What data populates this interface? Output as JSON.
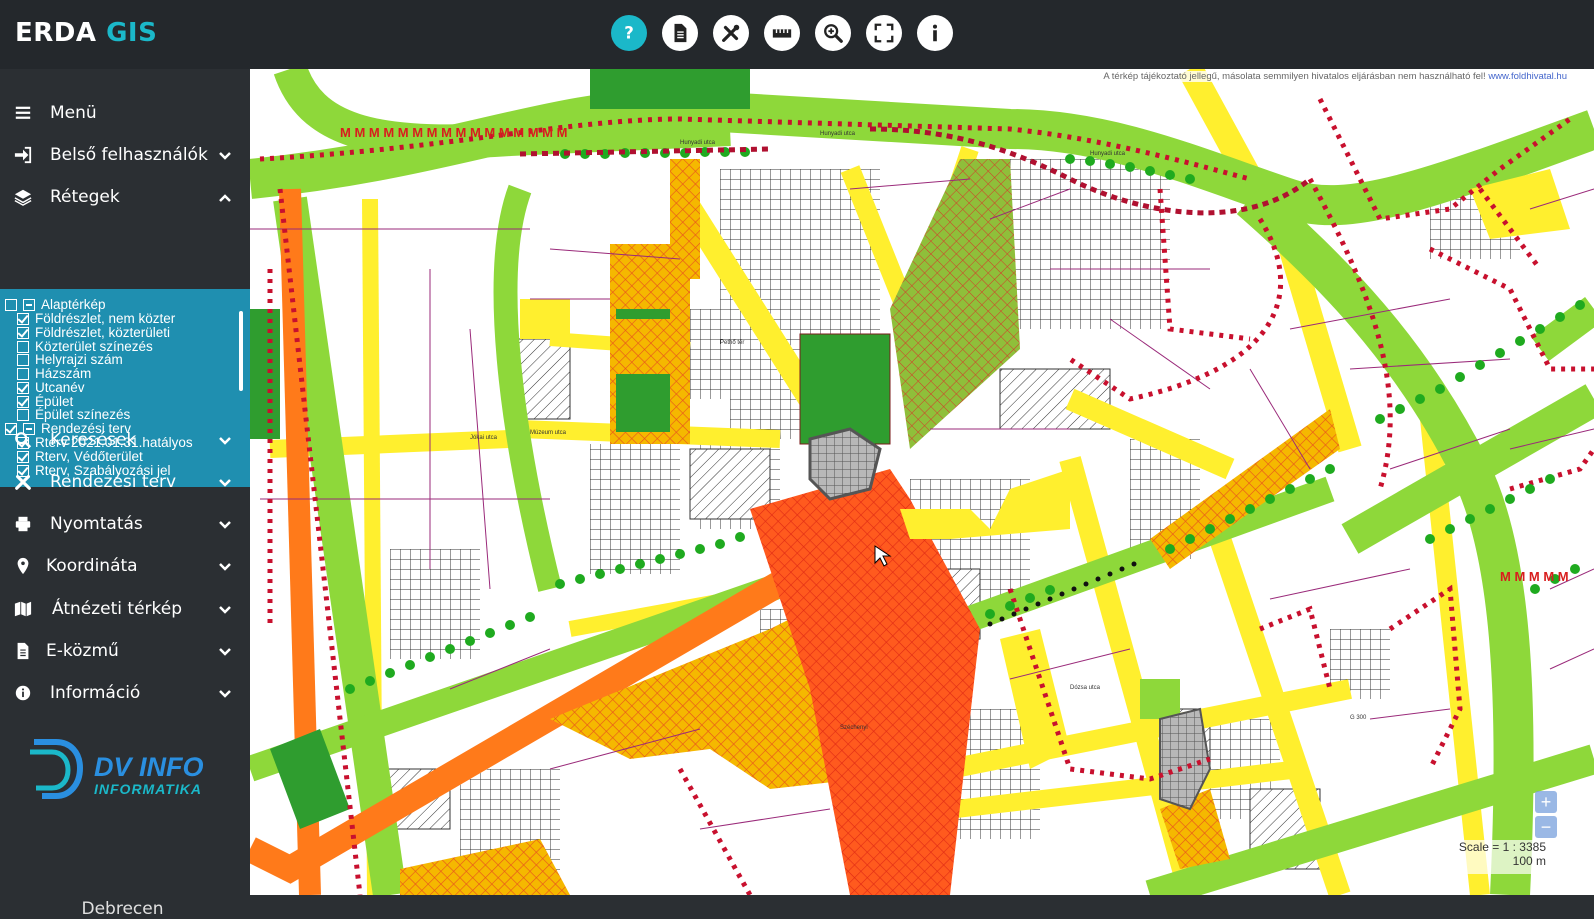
{
  "app": {
    "brand_main": "ERDA",
    "brand_accent": "GIS"
  },
  "toolbar": [
    {
      "name": "help-icon",
      "active": true
    },
    {
      "name": "document-icon",
      "active": false
    },
    {
      "name": "tools-icon",
      "active": false
    },
    {
      "name": "ruler-icon",
      "active": false
    },
    {
      "name": "zoom-icon",
      "active": false
    },
    {
      "name": "fullscreen-icon",
      "active": false
    },
    {
      "name": "info-icon",
      "active": false
    }
  ],
  "sidebar": {
    "menu": {
      "label": "Menü",
      "icon": "hamburger-icon"
    },
    "items": [
      {
        "label": "Belső felhasználók",
        "icon": "sign-in-icon",
        "expanded": false
      },
      {
        "label": "Rétegek",
        "icon": "layers-icon",
        "expanded": true
      },
      {
        "label": "Keresések",
        "icon": "search-icon",
        "expanded": false
      },
      {
        "label": "Rendezési terv",
        "icon": "tools-icon",
        "expanded": false
      },
      {
        "label": "Nyomtatás",
        "icon": "print-icon",
        "expanded": false
      },
      {
        "label": "Koordináta",
        "icon": "map-marker-icon",
        "expanded": false
      },
      {
        "label": "Átnézeti térkép",
        "icon": "map-icon",
        "expanded": false
      },
      {
        "label": "E-közmű",
        "icon": "file-icon",
        "expanded": false
      },
      {
        "label": "Információ",
        "icon": "info-circle-icon",
        "expanded": false
      }
    ],
    "layers": [
      {
        "label": "Alaptérkép",
        "type": "group"
      },
      {
        "label": "Földrészlet, nem közter",
        "checked": true
      },
      {
        "label": "Földrészlet, közterületi",
        "checked": true
      },
      {
        "label": "Közterület színezés",
        "checked": false
      },
      {
        "label": "Helyrajzi szám",
        "checked": false
      },
      {
        "label": "Házszám",
        "checked": false
      },
      {
        "label": "Utcanév",
        "checked": true
      },
      {
        "label": "Épület",
        "checked": true
      },
      {
        "label": "Épület színezés",
        "checked": false
      },
      {
        "label": "Rendezési terv",
        "type": "group"
      },
      {
        "label": "Rterv 2021.01.31.hatályos",
        "checked": true
      },
      {
        "label": "Rterv, Védőterület",
        "checked": true
      },
      {
        "label": "Rterv, Szabályozási jel",
        "checked": true
      }
    ],
    "logo": {
      "line1": "DV INFO",
      "line2": "INFORMATIKA"
    },
    "city": "Debrecen"
  },
  "map": {
    "disclaimer": "A térkép tájékoztató jellegű, másolata semmilyen hivatalos eljárásban nem használható fel!",
    "disclaimer_link": "www.foldhivatal.hu",
    "zoom_in": "+",
    "zoom_out": "−",
    "scale_text": "Scale = 1 : 3385",
    "scale_bar": "100 m"
  },
  "colors": {
    "accent": "#1bb8c9",
    "layers_panel": "#1f8fb0",
    "sidebar": "#2b2f33",
    "topbar": "#24282c"
  }
}
